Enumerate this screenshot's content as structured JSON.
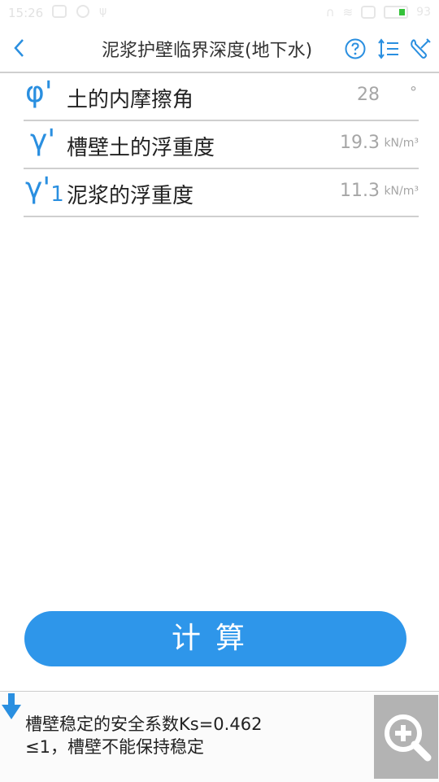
{
  "status_bar": {
    "time": "15:26",
    "battery_level": "93"
  },
  "header": {
    "back_icon": "chevron-left-icon",
    "title": "泥浆护壁临界深度(地下水)",
    "icons": [
      "help-circle-icon",
      "sort-list-icon",
      "settings-tools-icon"
    ],
    "accent_color": "#2a8fe0"
  },
  "inputs": [
    {
      "symbol": "φ'",
      "symbol_sub": "",
      "label": "土的内摩擦角",
      "value": "28",
      "unit": "°"
    },
    {
      "symbol": "γ'",
      "symbol_sub": "",
      "label": "槽壁土的浮重度",
      "value": "19.3",
      "unit": "kN/m³"
    },
    {
      "symbol": "γ'",
      "symbol_sub": "1",
      "label": "泥浆的浮重度",
      "value": "11.3",
      "unit": "kN/m³"
    }
  ],
  "calc_button": {
    "label": "计算",
    "color": "#2e96ea"
  },
  "result": {
    "line1": "槽壁稳定的安全系数Ks=0.462",
    "line2": "≤1，槽壁不能保持稳定",
    "arrow_icon": "arrow-down-icon",
    "zoom_icon": "zoom-in-icon"
  }
}
